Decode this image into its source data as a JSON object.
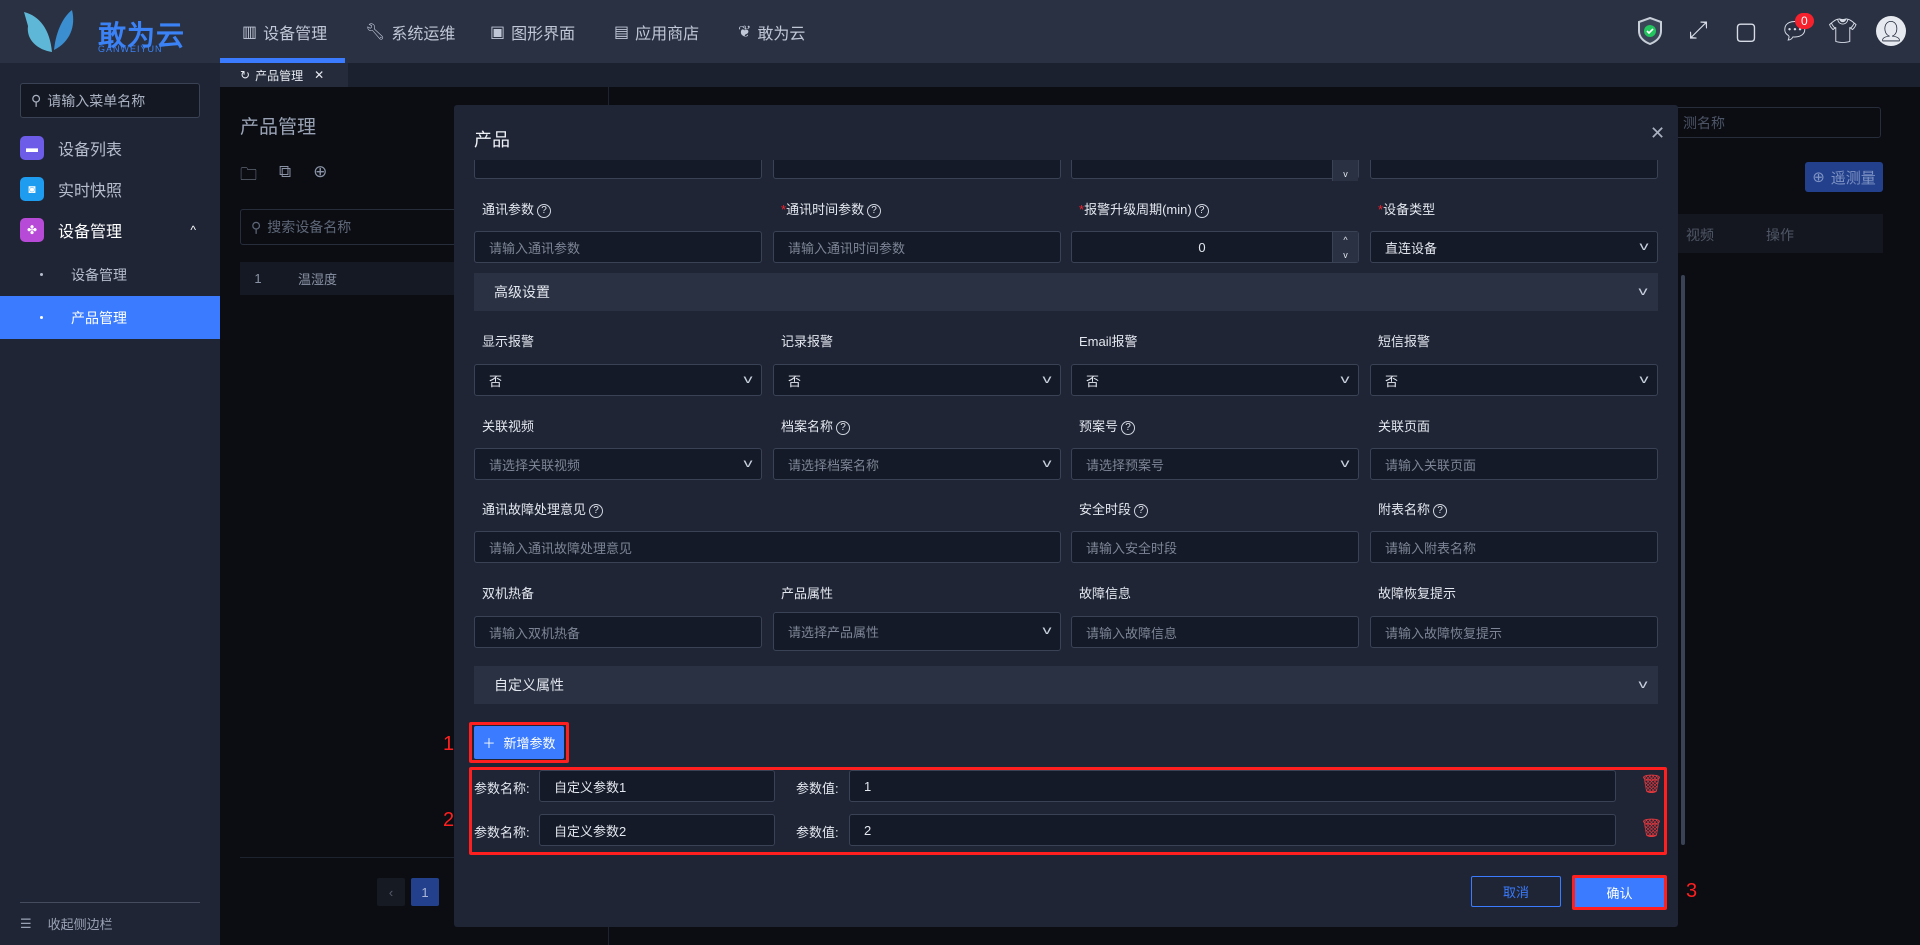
{
  "header": {
    "logo_text": "敢为云",
    "logo_sub": "GANWEIYUN",
    "nav": [
      {
        "label": "设备管理",
        "icon": "device-icon",
        "active": true
      },
      {
        "label": "系统运维",
        "icon": "wrench-icon"
      },
      {
        "label": "图形界面",
        "icon": "monitor-icon"
      },
      {
        "label": "应用商店",
        "icon": "store-icon"
      },
      {
        "label": "敢为云",
        "icon": "butterfly-icon"
      }
    ],
    "message_count": "0"
  },
  "tabs": [
    {
      "label": "产品管理"
    }
  ],
  "sidebar": {
    "search_placeholder": "请输入菜单名称",
    "items": [
      {
        "label": "设备列表",
        "color": "#6c5ce7"
      },
      {
        "label": "实时快照",
        "color": "#1e9cf0"
      },
      {
        "label": "设备管理",
        "color": "#b84ad8"
      }
    ],
    "sub_items": [
      {
        "label": "设备管理"
      },
      {
        "label": "产品管理"
      }
    ],
    "collapse_label": "收起侧边栏"
  },
  "left_panel": {
    "title": "产品管理",
    "search_placeholder": "搜索设备名称",
    "rows": [
      {
        "index": "1",
        "name": "温湿度"
      }
    ],
    "page": "1"
  },
  "right_panel": {
    "search_placeholder": "测名称",
    "add_button": "遥测量",
    "columns": [
      "视频",
      "操作"
    ]
  },
  "modal": {
    "title": "产品",
    "rows": [
      [
        {
          "label": "通讯参数",
          "help": true,
          "type": "input",
          "placeholder": "请输入通讯参数"
        },
        {
          "label": "通讯时间参数",
          "help": true,
          "required": true,
          "type": "input",
          "placeholder": "请输入通讯时间参数"
        },
        {
          "label": "报警升级周期(min)",
          "help": true,
          "required": true,
          "type": "number",
          "value": "0"
        },
        {
          "label": "设备类型",
          "required": true,
          "type": "select",
          "value": "直连设备"
        }
      ],
      [
        {
          "label": "显示报警",
          "type": "select",
          "value": "否"
        },
        {
          "label": "记录报警",
          "type": "select",
          "value": "否"
        },
        {
          "label": "Email报警",
          "type": "select",
          "value": "否"
        },
        {
          "label": "短信报警",
          "type": "select",
          "value": "否"
        }
      ],
      [
        {
          "label": "关联视频",
          "type": "select",
          "placeholder": "请选择关联视频"
        },
        {
          "label": "档案名称",
          "help": true,
          "type": "select",
          "placeholder": "请选择档案名称"
        },
        {
          "label": "预案号",
          "help": true,
          "type": "select",
          "placeholder": "请选择预案号"
        },
        {
          "label": "关联页面",
          "type": "input",
          "placeholder": "请输入关联页面"
        }
      ],
      [
        {
          "label": "通讯故障处理意见",
          "help": true,
          "type": "input",
          "placeholder": "请输入通讯故障处理意见",
          "span": 2
        },
        {
          "label": "安全时段",
          "help": true,
          "type": "input",
          "placeholder": "请输入安全时段"
        },
        {
          "label": "附表名称",
          "help": true,
          "type": "input",
          "placeholder": "请输入附表名称"
        }
      ],
      [
        {
          "label": "双机热备",
          "type": "input",
          "placeholder": "请输入双机热备"
        },
        {
          "label": "产品属性",
          "type": "select",
          "placeholder": "请选择产品属性"
        },
        {
          "label": "故障信息",
          "type": "input",
          "placeholder": "请输入故障信息"
        },
        {
          "label": "故障恢复提示",
          "type": "input",
          "placeholder": "请输入故障恢复提示"
        }
      ]
    ],
    "advanced_section": "高级设置",
    "custom_section": "自定义属性",
    "add_param_button": "新增参数",
    "param_name_label": "参数名称:",
    "param_value_label": "参数值:",
    "params": [
      {
        "name": "自定义参数1",
        "value": "1"
      },
      {
        "name": "自定义参数2",
        "value": "2"
      }
    ],
    "cancel_button": "取消",
    "confirm_button": "确认",
    "annotations": [
      "1",
      "2",
      "3"
    ]
  }
}
